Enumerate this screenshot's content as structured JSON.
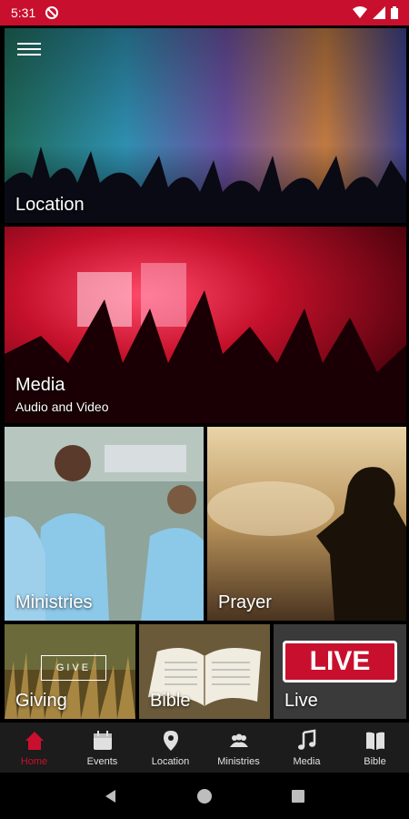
{
  "status_bar": {
    "time": "5:31"
  },
  "tiles": {
    "location": {
      "label": "Location"
    },
    "media": {
      "label": "Media",
      "sublabel": "Audio and Video"
    },
    "ministries": {
      "label": "Ministries"
    },
    "prayer": {
      "label": "Prayer"
    },
    "giving": {
      "label": "Giving",
      "sign_text": "GIVE"
    },
    "bible": {
      "label": "Bible"
    },
    "live": {
      "label": "Live",
      "badge_text": "LIVE"
    }
  },
  "bottom_nav": {
    "items": [
      {
        "label": "Home",
        "icon": "home-icon",
        "active": true
      },
      {
        "label": "Events",
        "icon": "calendar-icon",
        "active": false
      },
      {
        "label": "Location",
        "icon": "map-pin-icon",
        "active": false
      },
      {
        "label": "Ministries",
        "icon": "people-icon",
        "active": false
      },
      {
        "label": "Media",
        "icon": "music-note-icon",
        "active": false
      },
      {
        "label": "Bible",
        "icon": "book-icon",
        "active": false
      }
    ]
  },
  "colors": {
    "accent": "#c8102e",
    "nav_bg": "#1c1c1c",
    "nav_text": "#e0e0e0"
  }
}
